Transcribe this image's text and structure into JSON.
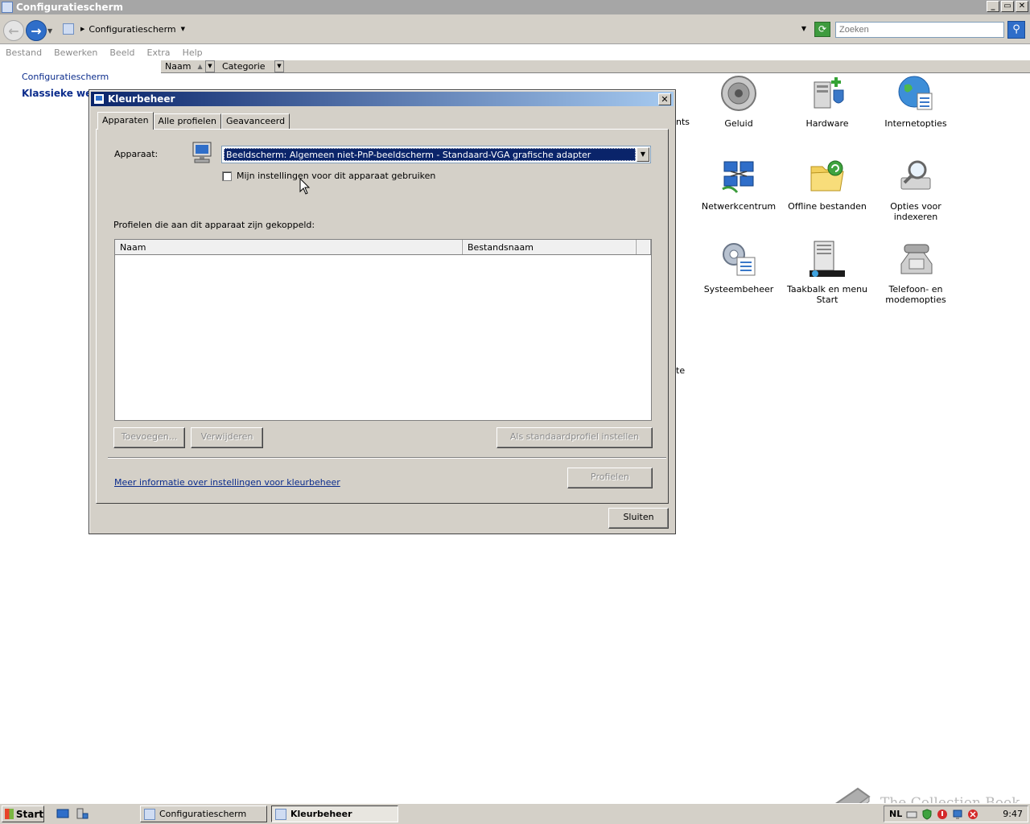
{
  "window": {
    "title": "Configuratiescherm",
    "controls": [
      "_",
      "▭",
      "✕"
    ]
  },
  "address": {
    "path": "Configuratiescherm",
    "search_placeholder": "Zoeken"
  },
  "menu": [
    "Bestand",
    "Bewerken",
    "Beeld",
    "Extra",
    "Help"
  ],
  "columns": {
    "name": "Naam",
    "category": "Categorie"
  },
  "left_pane": {
    "link": "Configuratiescherm",
    "bold": "Klassieke weergave"
  },
  "control_panel_items": [
    {
      "label": "Geluid",
      "icon": "speaker-icon"
    },
    {
      "label": "Hardware",
      "icon": "hardware-icon"
    },
    {
      "label": "Internetopties",
      "icon": "globe-icon"
    },
    {
      "label": "Netwerkcentrum",
      "icon": "network-icon"
    },
    {
      "label": "Offline bestanden",
      "icon": "folder-sync-icon"
    },
    {
      "label": "Opties voor indexeren",
      "icon": "index-icon"
    },
    {
      "label": "Systeembeheer",
      "icon": "admin-tools-icon"
    },
    {
      "label": "Taakbalk en menu Start",
      "icon": "taskbar-icon"
    },
    {
      "label": "Telefoon- en modemopties",
      "icon": "phone-icon"
    }
  ],
  "partial_texts": [
    "nts",
    "te"
  ],
  "dialog": {
    "title": "Kleurbeheer",
    "tabs": [
      "Apparaten",
      "Alle profielen",
      "Geavanceerd"
    ],
    "device_label": "Apparaat:",
    "device_value": "Beeldscherm: Algemeen niet-PnP-beeldscherm - Standaard-VGA grafische adapter",
    "checkbox_label": "Mijn instellingen voor dit apparaat gebruiken",
    "profiles_label": "Profielen die aan dit apparaat zijn gekoppeld:",
    "list_columns": [
      "Naam",
      "Bestandsnaam"
    ],
    "buttons": {
      "add": "Toevoegen...",
      "remove": "Verwijderen",
      "set_default": "Als standaardprofiel instellen",
      "profiles": "Profielen",
      "close": "Sluiten"
    },
    "more_info_link": "Meer informatie over instellingen voor kleurbeheer"
  },
  "taskbar": {
    "start": "Start",
    "items": [
      "Configuratiescherm",
      "Kleurbeheer"
    ],
    "language": "NL",
    "clock": "9:47"
  },
  "watermark": "The Collection Book"
}
